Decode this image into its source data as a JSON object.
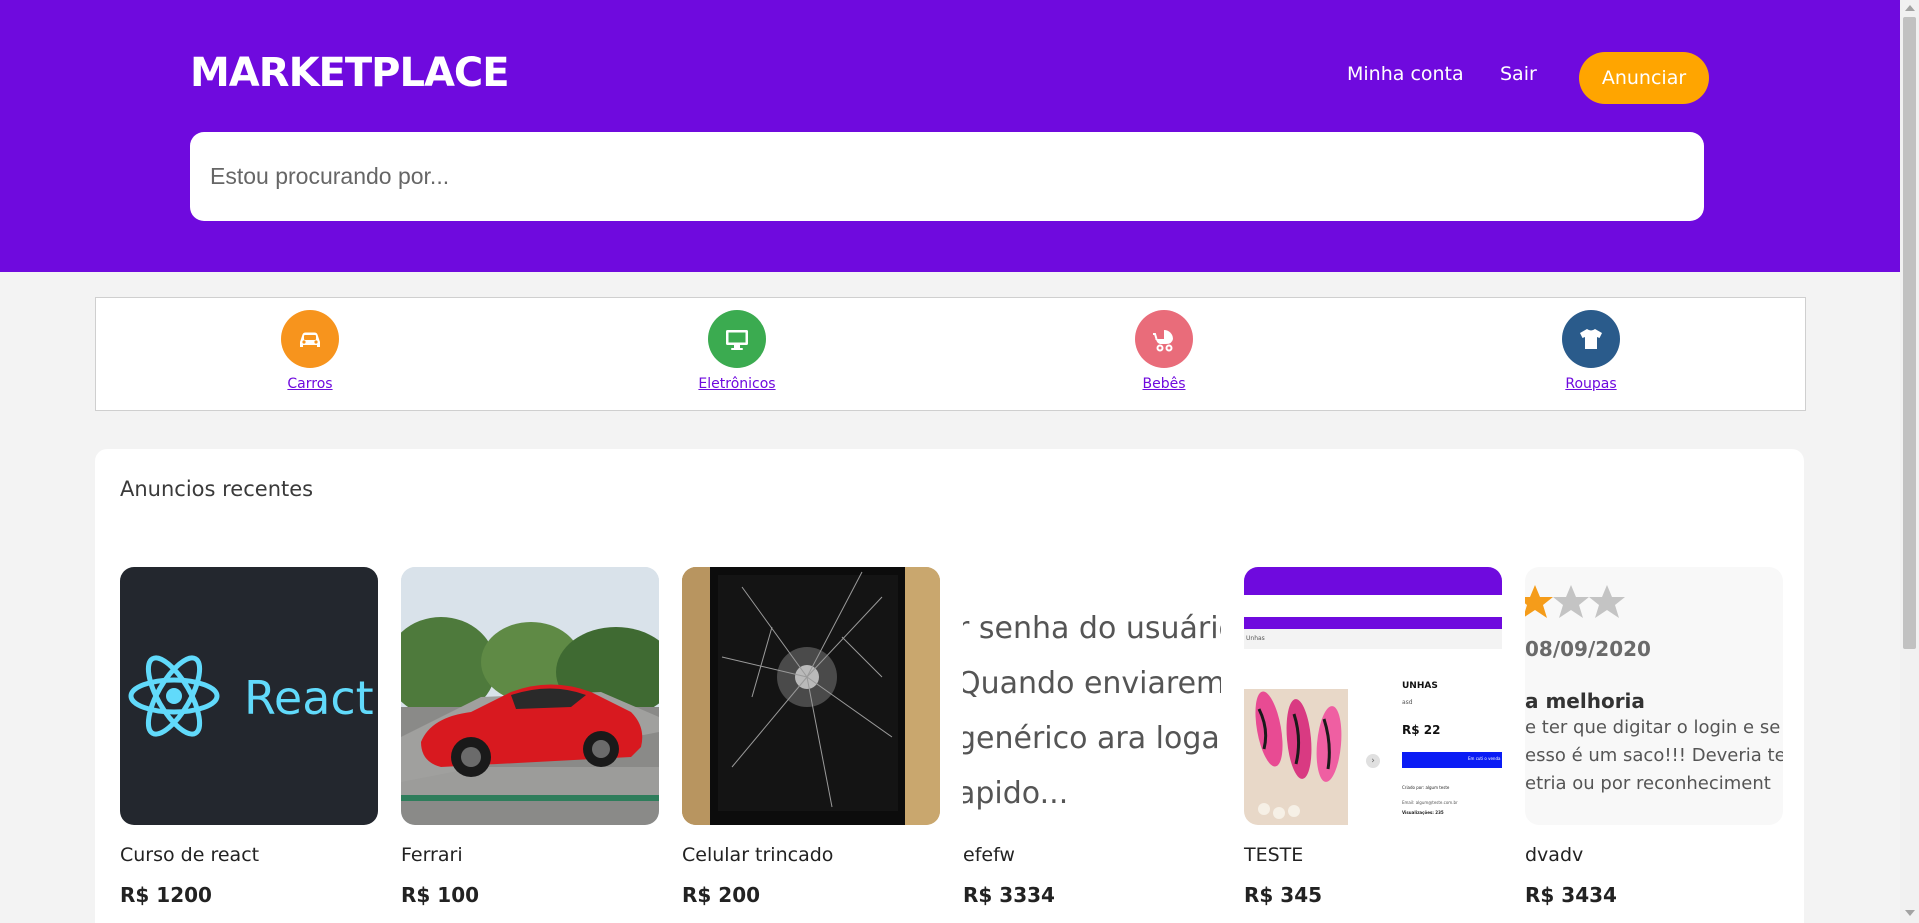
{
  "header": {
    "logo": "MARKETPLACE",
    "nav": {
      "account": "Minha conta",
      "logout": "Sair",
      "announce": "Anunciar"
    },
    "search": {
      "placeholder": "Estou procurando por..."
    }
  },
  "categories": [
    {
      "label": "Carros",
      "icon": "car-icon",
      "color": "#f7941d"
    },
    {
      "label": "Eletrônicos",
      "icon": "monitor-icon",
      "color": "#3bab50"
    },
    {
      "label": "Bebês",
      "icon": "stroller-icon",
      "color": "#e96c7a"
    },
    {
      "label": "Roupas",
      "icon": "shirt-icon",
      "color": "#2a5b8b"
    }
  ],
  "recent": {
    "title": "Anuncios recentes",
    "ads": [
      {
        "title": "Curso de react",
        "price": "R$ 1200",
        "thumb_text": "React"
      },
      {
        "title": "Ferrari",
        "price": "R$ 100"
      },
      {
        "title": "Celular trincado",
        "price": "R$ 200"
      },
      {
        "title": "efefw",
        "price": "R$ 3334",
        "thumb_lines": [
          "r senha do usuário",
          "Quando enviarem o",
          "genérico ara logar r",
          "apido..."
        ]
      },
      {
        "title": "TESTE",
        "price": "R$ 345",
        "thumb_texts": {
          "header": "Unhas",
          "title": "UNHAS",
          "sub": "asd",
          "price": "R$ 22",
          "btn": "Em cuti o venda",
          "info1": "Criado por: algum teste",
          "info2": "Email: algum@teste.com.br",
          "info3": "Visualizações: 235"
        }
      },
      {
        "title": "dvadv",
        "price": "R$ 3434",
        "thumb_texts": {
          "date": "08/09/2020",
          "heading": "a melhoria",
          "line1": "e ter que digitar o login e se",
          "line2": "esso é um saco!!! Deveria te",
          "line3": "etria ou por reconheciment"
        }
      }
    ]
  },
  "colors": {
    "brand": "#6f0ade",
    "accent": "#ffa500"
  }
}
